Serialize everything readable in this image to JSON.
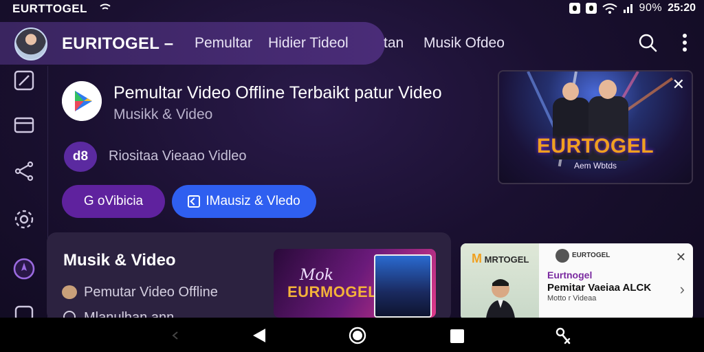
{
  "status_bar": {
    "app_name": "EURTTOGEL",
    "battery": "90%",
    "time": "25:20"
  },
  "app_bar": {
    "brand": "EURITOGEL –",
    "nav": [
      "Pemultar",
      "Hidier Tideol",
      "tan",
      "Musik Ofdeo"
    ]
  },
  "hero": {
    "title": "Pemultar Video Offline Terbaikt patur  Video",
    "subtitle": "Musikk & Video",
    "developer_badge": "d8",
    "developer_name": "Riositaa Vieaao Vidleo",
    "primary_button": "G oVibicia",
    "secondary_button": "IMausiz & Vledo"
  },
  "video_card": {
    "logo": "EURTOGEL",
    "caption": "Aem Wbtds"
  },
  "music_card": {
    "heading": "Musik & Video",
    "line1": "Pemutar Video Offline",
    "line2": "Mlanulhan ann",
    "promo_script": "Mok",
    "promo_logo": "EURMOGEL"
  },
  "ad": {
    "brand": "MRTOGEL",
    "org": "EURTOGEL",
    "title": "Eurtnogel",
    "headline": "Pemitar Vaeiaa ALCK",
    "subline": "Motto r Videaa"
  },
  "colors": {
    "accent_purple": "#5f229e",
    "accent_blue": "#2f5ff0",
    "brand_orange": "#f0a020",
    "background": "#1a1030"
  }
}
